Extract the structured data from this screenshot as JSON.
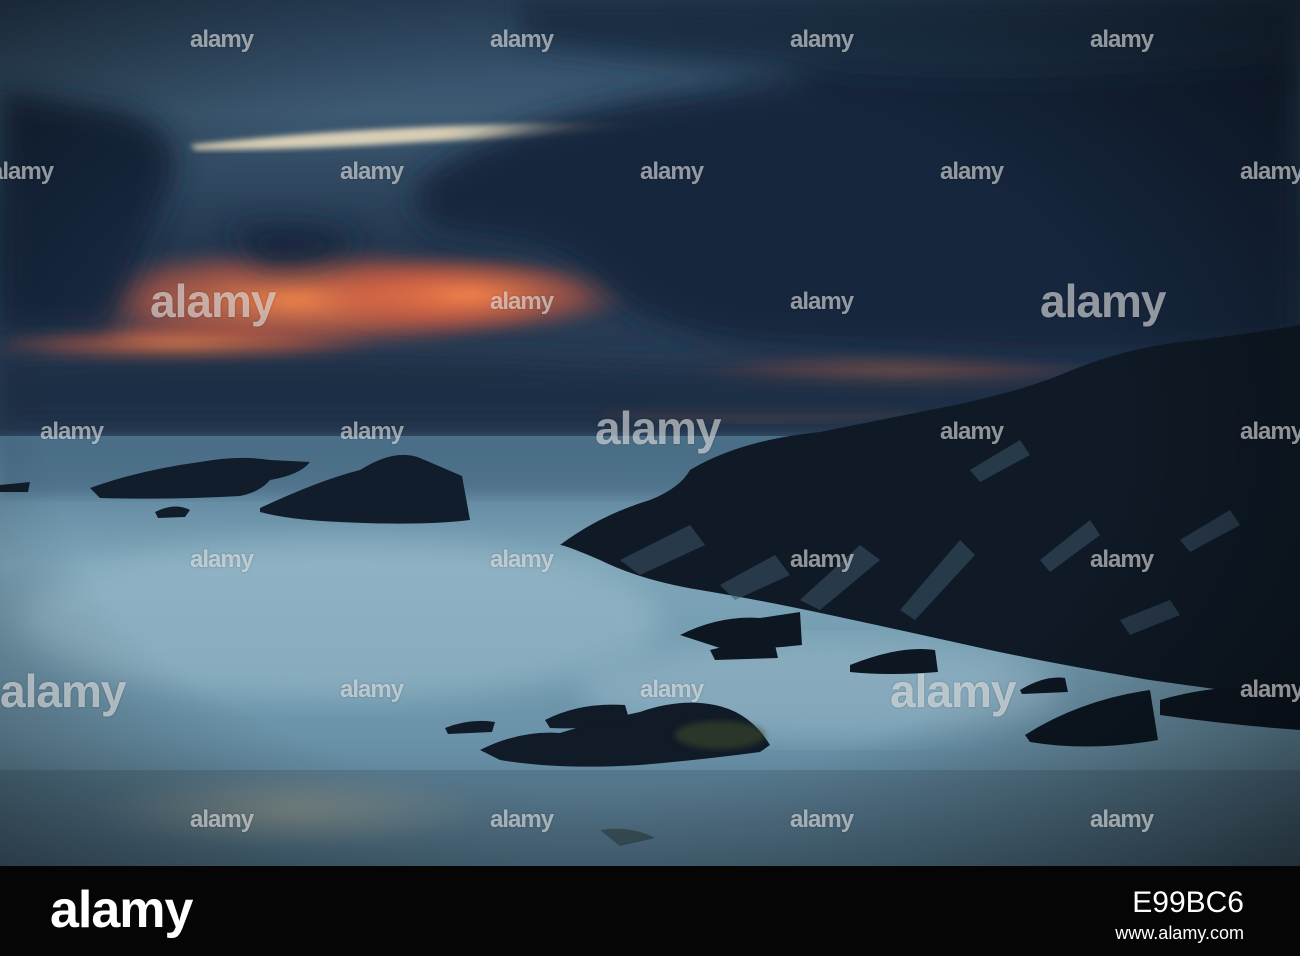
{
  "photo": {
    "subject": "long exposure seascape at dusk with dark jagged rocks and misty sea",
    "colors": {
      "sky_top": "#20364f",
      "sky_glow": "#f07a48",
      "cloud_dark": "#18283f",
      "sea": "#6f98ae",
      "rock": "#0f1a26"
    }
  },
  "watermark": {
    "brand": "alamy"
  },
  "footer": {
    "logo": "alamy",
    "image_id": "E99BC6",
    "url": "www.alamy.com"
  }
}
